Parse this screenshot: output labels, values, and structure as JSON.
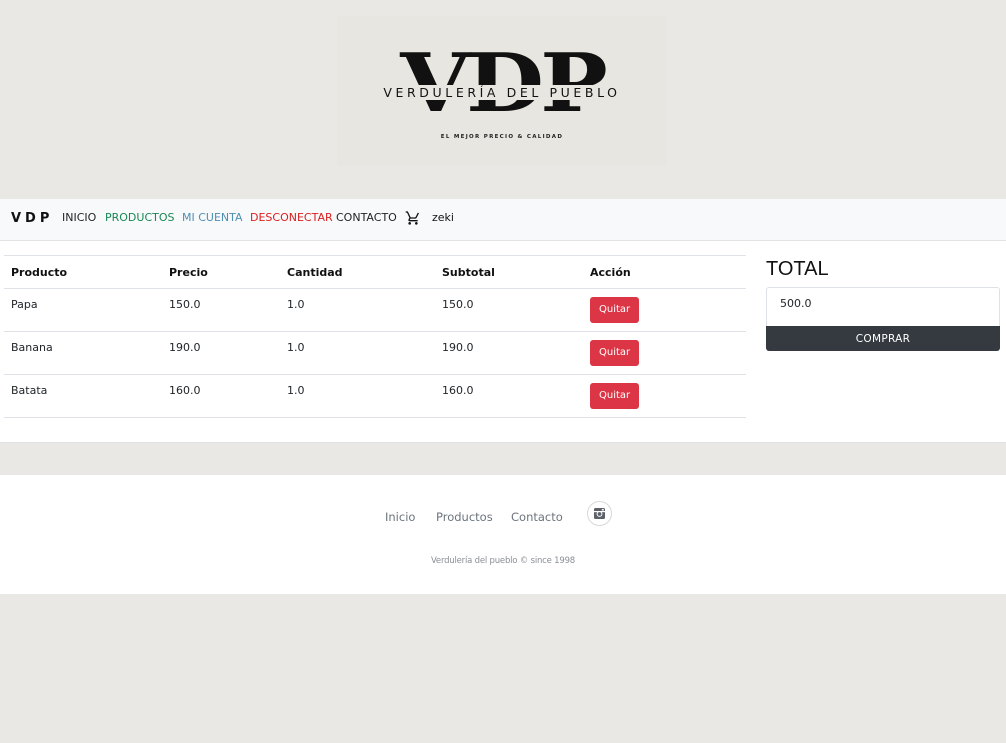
{
  "logo": {
    "big_text": "VDP",
    "name": "VERDULERÍA DEL PUEBLO",
    "tagline": "EL MEJOR PRECIO & CALIDAD"
  },
  "navbar": {
    "brand": "VDP",
    "items": [
      {
        "label": "INICIO",
        "color": "#212529"
      },
      {
        "label": "PRODUCTOS",
        "color": "#198754"
      },
      {
        "label": "MI CUENTA",
        "color": "#4f8fb3"
      },
      {
        "label": "DESCONECTAR",
        "color": "#dc1d1d"
      },
      {
        "label": "CONTACTO",
        "color": "#212529"
      }
    ],
    "cart_icon": "cart-icon",
    "user": "zeki"
  },
  "cart": {
    "headers": [
      "Producto",
      "Precio",
      "Cantidad",
      "Subtotal",
      "Acción"
    ],
    "rows": [
      {
        "producto": "Papa",
        "precio": "150.0",
        "cantidad": "1.0",
        "subtotal": "150.0",
        "accion": "Quitar"
      },
      {
        "producto": "Banana",
        "precio": "190.0",
        "cantidad": "1.0",
        "subtotal": "190.0",
        "accion": "Quitar"
      },
      {
        "producto": "Batata",
        "precio": "160.0",
        "cantidad": "1.0",
        "subtotal": "160.0",
        "accion": "Quitar"
      }
    ]
  },
  "total": {
    "title": "TOTAL",
    "value": "500.0",
    "buy_label": "COMPRAR"
  },
  "footer": {
    "links": [
      "Inicio",
      "Productos",
      "Contacto"
    ],
    "social_icon": "instagram-icon",
    "copyright": "Verdulería del pueblo © since 1998"
  },
  "colors": {
    "danger": "#dc3545",
    "dark": "#343a40",
    "page_bg": "#e9e8e4",
    "navbar_bg": "#f8f9fa"
  }
}
